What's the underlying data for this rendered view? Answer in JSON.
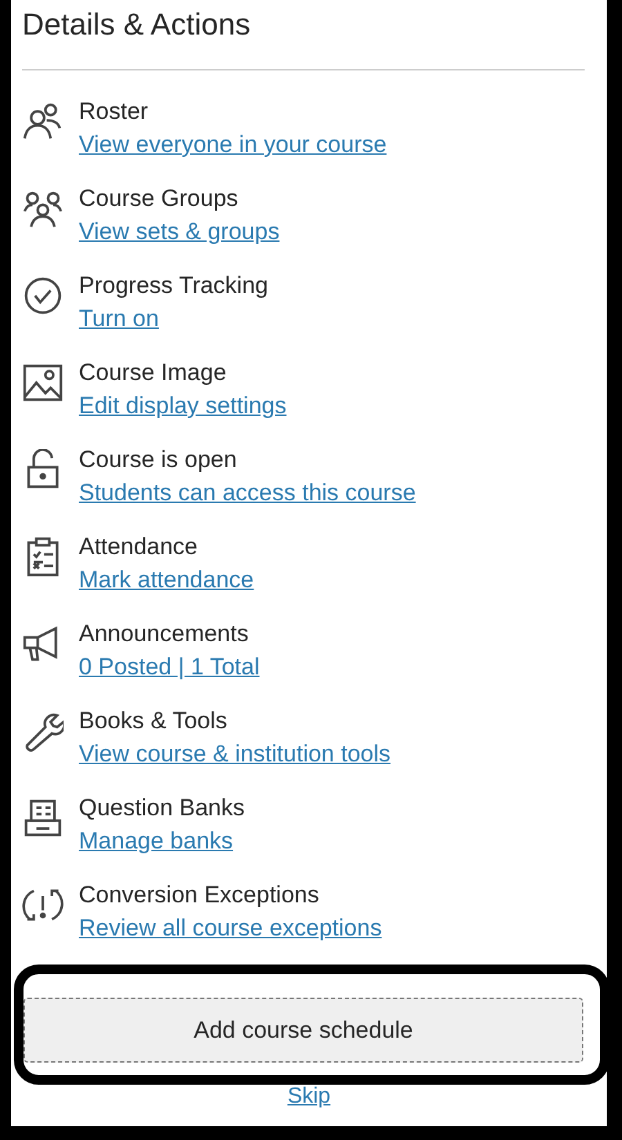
{
  "panel": {
    "title": "Details & Actions"
  },
  "items": [
    {
      "kind": "roster",
      "title": "Roster",
      "link": "View everyone in your course"
    },
    {
      "kind": "groups",
      "title": "Course Groups",
      "link": "View sets & groups"
    },
    {
      "kind": "progress",
      "title": "Progress Tracking",
      "link": "Turn on"
    },
    {
      "kind": "image",
      "title": "Course Image",
      "link": "Edit display settings"
    },
    {
      "kind": "lock",
      "title": "Course is open",
      "link": "Students can access this course"
    },
    {
      "kind": "attendance",
      "title": "Attendance",
      "link": "Mark attendance"
    },
    {
      "kind": "announcements",
      "title": "Announcements",
      "link": "0 Posted | 1 Total"
    },
    {
      "kind": "tools",
      "title": "Books & Tools",
      "link": "View course & institution tools"
    },
    {
      "kind": "banks",
      "title": "Question Banks",
      "link": "Manage banks"
    },
    {
      "kind": "exceptions",
      "title": "Conversion Exceptions",
      "link": "Review all course exceptions"
    }
  ],
  "schedule_button": {
    "label": "Add course schedule"
  },
  "skip_link": "Skip"
}
